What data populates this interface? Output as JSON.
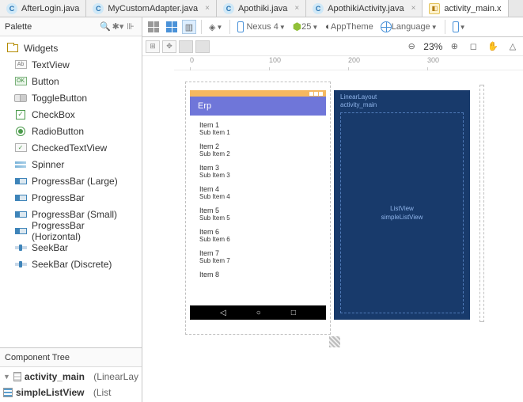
{
  "tabs": [
    {
      "label": "AfterLogin.java",
      "icon": "c"
    },
    {
      "label": "MyCustomAdapter.java",
      "icon": "c"
    },
    {
      "label": "Apothiki.java",
      "icon": "c"
    },
    {
      "label": "ApothikiActivity.java",
      "icon": "c"
    },
    {
      "label": "activity_main.x",
      "icon": "x"
    }
  ],
  "palette": {
    "title": "Palette",
    "root": "Widgets",
    "items": [
      "TextView",
      "Button",
      "ToggleButton",
      "CheckBox",
      "RadioButton",
      "CheckedTextView",
      "Spinner",
      "ProgressBar (Large)",
      "ProgressBar",
      "ProgressBar (Small)",
      "ProgressBar (Horizontal)",
      "SeekBar",
      "SeekBar (Discrete)"
    ]
  },
  "componentTree": {
    "title": "Component Tree",
    "root": {
      "name": "activity_main",
      "type": "(LinearLay"
    },
    "child": {
      "name": "simpleListView",
      "type": "(List"
    }
  },
  "toolbar": {
    "device": "Nexus 4",
    "api": "25",
    "theme": "AppTheme",
    "language": "Language"
  },
  "zoom": "23%",
  "ruler": [
    "0",
    "100",
    "200",
    "300"
  ],
  "preview": {
    "appTitle": "Erp",
    "rows": [
      {
        "t": "Item 1",
        "s": "Sub Item 1"
      },
      {
        "t": "Item 2",
        "s": "Sub Item 2"
      },
      {
        "t": "Item 3",
        "s": "Sub Item 3"
      },
      {
        "t": "Item 4",
        "s": "Sub Item 4"
      },
      {
        "t": "Item 5",
        "s": "Sub Item 5"
      },
      {
        "t": "Item 6",
        "s": "Sub Item 6"
      },
      {
        "t": "Item 7",
        "s": "Sub Item 7"
      },
      {
        "t": "Item 8",
        "s": ""
      }
    ]
  },
  "blueprint": {
    "outer1": "LinearLayout",
    "outer2": "activity_main",
    "inner1": "ListView",
    "inner2": "simpleListView"
  }
}
